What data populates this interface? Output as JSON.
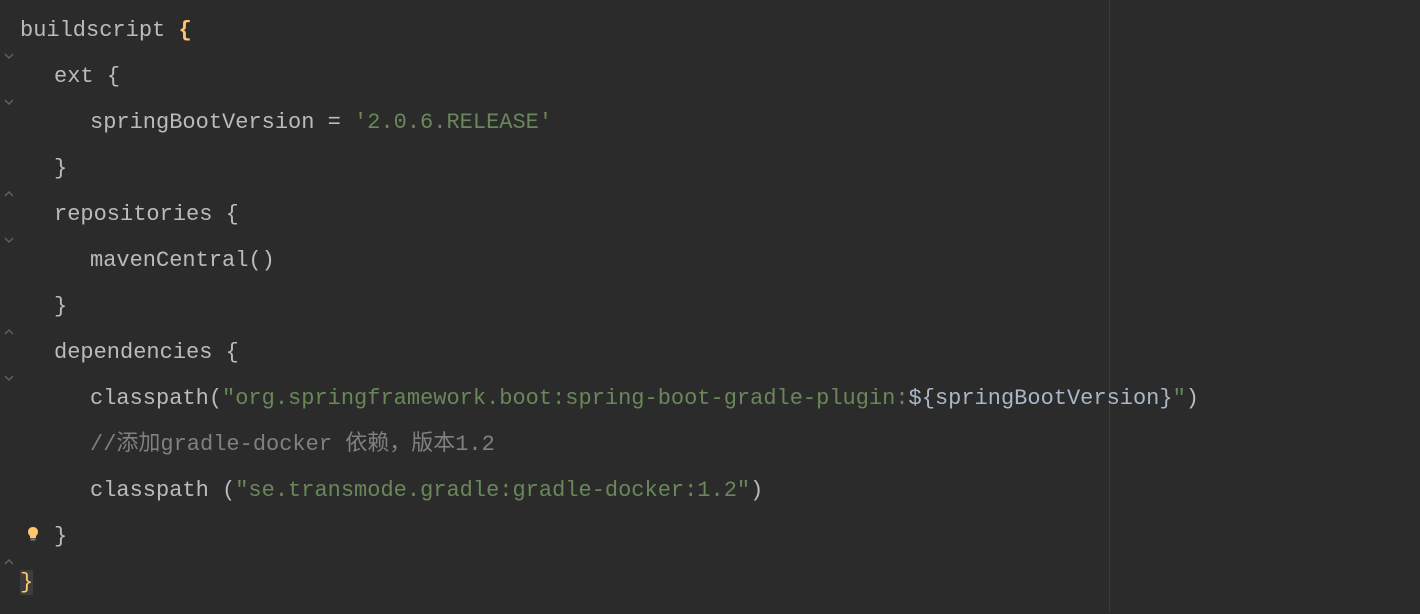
{
  "code": {
    "line1": {
      "keyword": "buildscript ",
      "brace": "{"
    },
    "line2": {
      "keyword": "ext ",
      "brace": "{"
    },
    "line3": {
      "var": "springBootVersion",
      "op": " = ",
      "string": "'2.0.6.RELEASE'"
    },
    "line4": {
      "brace": "}"
    },
    "line5": {
      "keyword": "repositories ",
      "brace": "{"
    },
    "line6": {
      "call": "mavenCentral()"
    },
    "line7": {
      "brace": "}"
    },
    "line8": {
      "keyword": "dependencies ",
      "brace": "{"
    },
    "line9": {
      "call": "classpath(",
      "string": "\"org.springframework.boot:spring-boot-gradle-plugin:",
      "var": "${springBootVersion}",
      "stringEnd": "\"",
      "close": ")"
    },
    "line10": {
      "comment": "//添加gradle-docker 依赖，版本1.2"
    },
    "line11": {
      "call": "classpath (",
      "string": "\"se.transmode.gradle:gradle-docker:1.2\"",
      "close": ")"
    },
    "line12": {
      "brace": "}"
    },
    "line13": {
      "brace": "}"
    }
  }
}
